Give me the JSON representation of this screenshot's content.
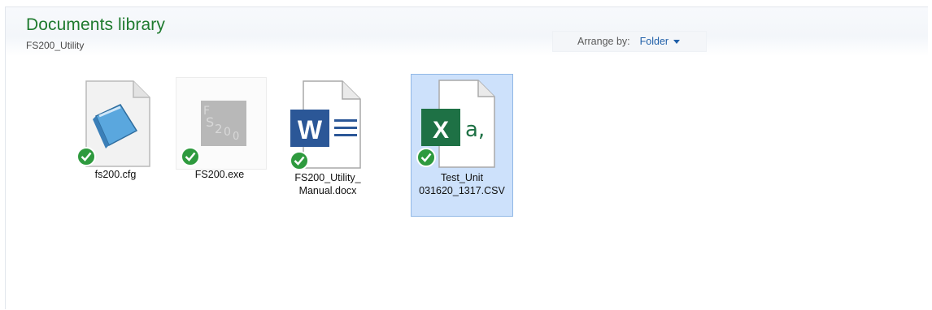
{
  "library": {
    "title": "Documents library",
    "path": "FS200_Utility"
  },
  "arrange": {
    "label": "Arrange by:",
    "value": "Folder"
  },
  "files": [
    {
      "name": "fs200.cfg",
      "icon": "notepad-file-icon",
      "sync": "synced"
    },
    {
      "name": "FS200.exe",
      "icon": "fs200-app-icon",
      "sync": "synced"
    },
    {
      "name_line1": "FS200_Utility_",
      "name_line2": "Manual.docx",
      "icon": "word-document-icon",
      "sync": "synced"
    },
    {
      "name_line1": "Test_Unit",
      "name_line2": "031620_1317.CSV",
      "icon": "excel-csv-icon",
      "sync": "synced",
      "selected": true
    }
  ],
  "colors": {
    "title_green": "#1e7a2e",
    "link_blue": "#1f5fa8",
    "selection": "#cde1fb",
    "sync_check": "#2e9a3e",
    "word_blue": "#2b5797",
    "excel_green": "#1e7145"
  }
}
